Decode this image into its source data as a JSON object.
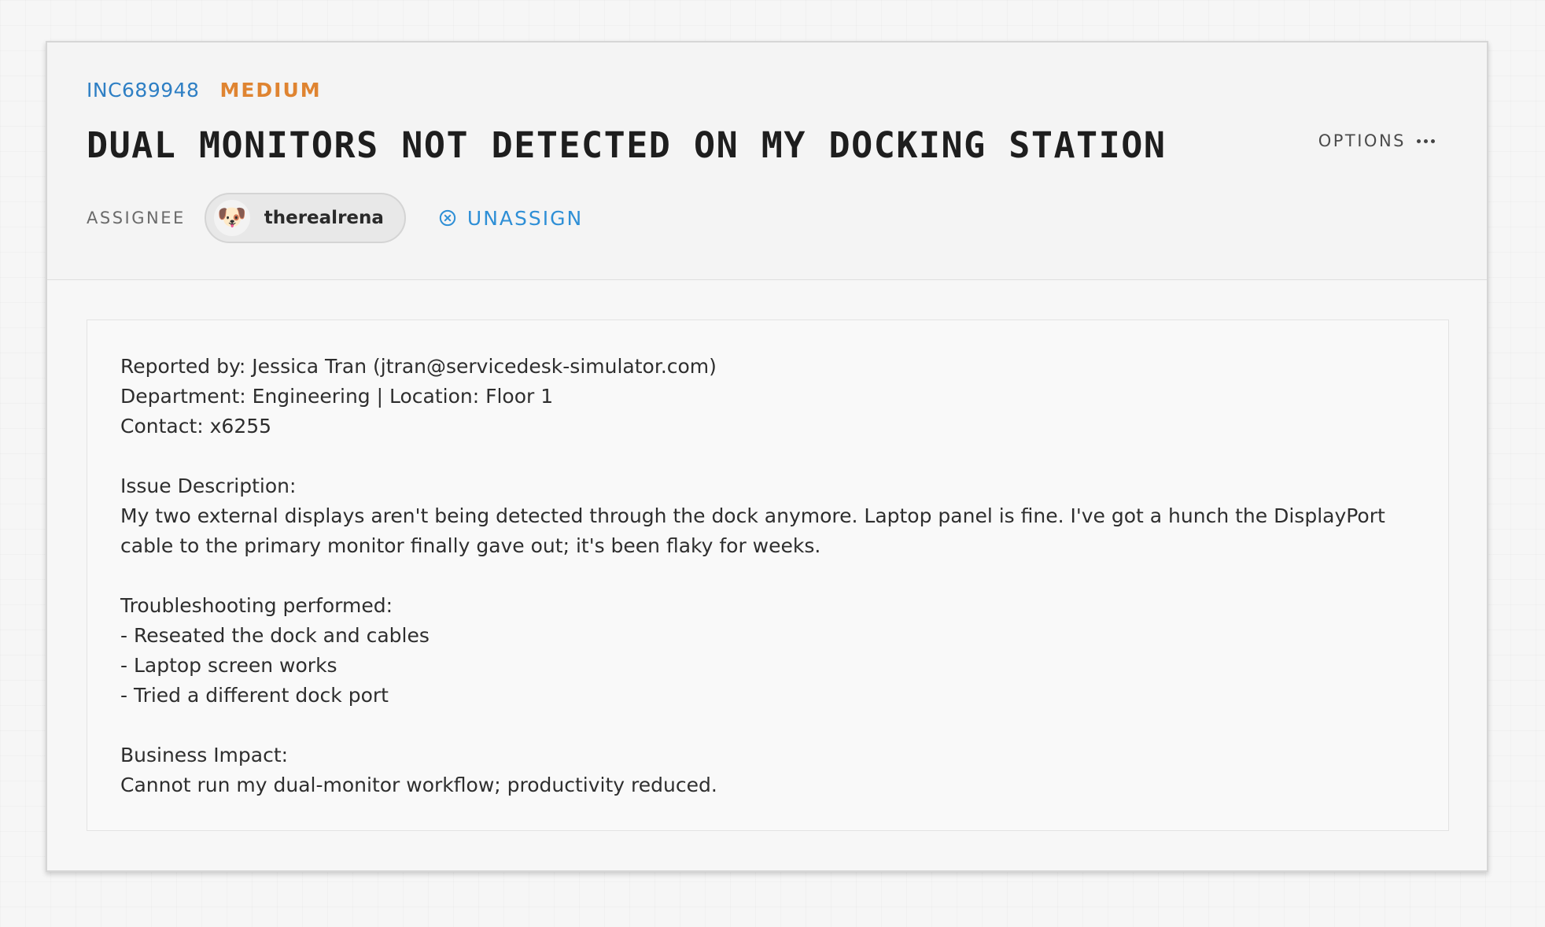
{
  "ticket": {
    "id": "INC689948",
    "priority": "MEDIUM",
    "title": "DUAL MONITORS NOT DETECTED ON MY DOCKING STATION"
  },
  "options": {
    "label": "OPTIONS",
    "icon": "more-horizontal-icon"
  },
  "assignee": {
    "label": "ASSIGNEE",
    "name": "therealrena",
    "avatar_glyph": "🐶",
    "avatar_icon": "dog-face-icon"
  },
  "unassign": {
    "label": "UNASSIGN",
    "icon": "circle-x-icon"
  },
  "description": {
    "text": "Reported by: Jessica Tran (jtran@servicedesk-simulator.com)\nDepartment: Engineering | Location: Floor 1\nContact: x6255\n\nIssue Description:\nMy two external displays aren't being detected through the dock anymore. Laptop panel is fine. I've got a hunch the DisplayPort cable to the primary monitor finally gave out; it's been flaky for weeks.\n\nTroubleshooting performed:\n- Reseated the dock and cables\n- Laptop screen works\n- Tried a different dock port\n\nBusiness Impact:\nCannot run my dual-monitor workflow; productivity reduced."
  },
  "colors": {
    "ticket_id": "#2e7fc4",
    "priority_medium": "#df8431",
    "accent_link": "#2e8fd6",
    "title_text": "#1e1e1e"
  }
}
